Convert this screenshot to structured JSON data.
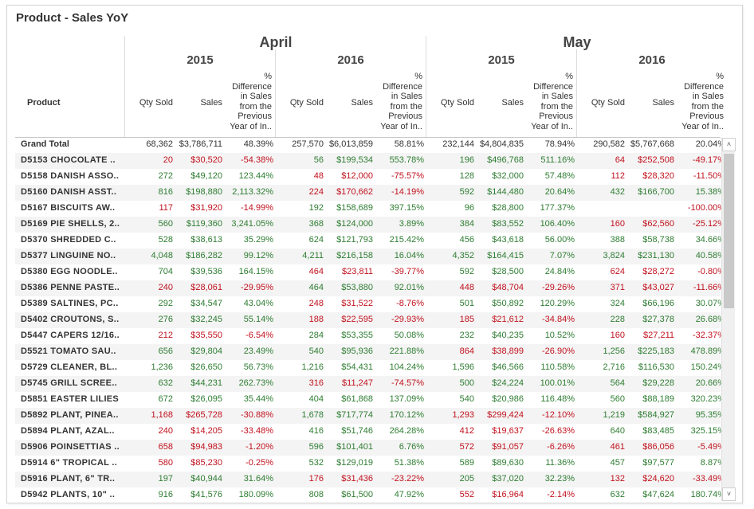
{
  "title": "Product - Sales YoY",
  "months": [
    "April",
    "May"
  ],
  "years": [
    "2015",
    "2016",
    "2015",
    "2016"
  ],
  "headers": {
    "product": "Product",
    "qty": "Qty Sold",
    "sales": "Sales",
    "pct_lines": [
      "%",
      "Difference",
      "in Sales",
      "from the",
      "Previous",
      "Year of In.."
    ]
  },
  "grand_total": {
    "label": "Grand Total",
    "cells": [
      "68,362",
      "$3,786,711",
      "48.39%",
      "257,570",
      "$6,013,859",
      "58.81%",
      "232,144",
      "$4,804,835",
      "78.94%",
      "290,582",
      "$5,767,668",
      "20.04%"
    ]
  },
  "rows": [
    {
      "product": "D5153  CHOCOLATE ..",
      "cells": [
        "20",
        "$30,520",
        "-54.38%",
        "56",
        "$199,534",
        "553.78%",
        "196",
        "$496,768",
        "511.16%",
        "64",
        "$252,508",
        "-49.17%"
      ]
    },
    {
      "product": "D5158  DANISH ASSO..",
      "cells": [
        "272",
        "$49,120",
        "123.44%",
        "48",
        "$12,000",
        "-75.57%",
        "128",
        "$32,000",
        "57.48%",
        "112",
        "$28,320",
        "-11.50%"
      ]
    },
    {
      "product": "D5160  DANISH ASST..",
      "cells": [
        "816",
        "$198,880",
        "2,113.32%",
        "224",
        "$170,662",
        "-14.19%",
        "592",
        "$144,480",
        "20.64%",
        "432",
        "$166,700",
        "15.38%"
      ]
    },
    {
      "product": "D5167  BISCUITS AW..",
      "cells": [
        "117",
        "$31,920",
        "-14.99%",
        "192",
        "$158,689",
        "397.15%",
        "96",
        "$28,800",
        "177.37%",
        "",
        "",
        "-100.00%"
      ]
    },
    {
      "product": "D5169  PIE SHELLS, 2..",
      "cells": [
        "560",
        "$119,360",
        "3,241.05%",
        "368",
        "$124,000",
        "3.89%",
        "384",
        "$83,552",
        "106.40%",
        "160",
        "$62,560",
        "-25.12%"
      ]
    },
    {
      "product": "D5370  SHREDDED C..",
      "cells": [
        "528",
        "$38,613",
        "35.29%",
        "624",
        "$121,793",
        "215.42%",
        "456",
        "$43,618",
        "56.00%",
        "388",
        "$58,738",
        "34.66%"
      ]
    },
    {
      "product": "D5377  LINGUINE NO..",
      "cells": [
        "4,048",
        "$186,282",
        "99.12%",
        "4,211",
        "$216,158",
        "16.04%",
        "4,352",
        "$164,415",
        "7.07%",
        "3,824",
        "$231,130",
        "40.58%"
      ]
    },
    {
      "product": "D5380  EGG NOODLE..",
      "cells": [
        "704",
        "$39,536",
        "164.15%",
        "464",
        "$23,811",
        "-39.77%",
        "592",
        "$28,500",
        "24.84%",
        "624",
        "$28,272",
        "-0.80%"
      ]
    },
    {
      "product": "D5386  PENNE PASTE..",
      "cells": [
        "240",
        "$28,061",
        "-29.95%",
        "464",
        "$53,880",
        "92.01%",
        "448",
        "$48,704",
        "-29.26%",
        "371",
        "$43,027",
        "-11.66%"
      ]
    },
    {
      "product": "D5389  SALTINES, PC..",
      "cells": [
        "292",
        "$34,547",
        "43.04%",
        "248",
        "$31,522",
        "-8.76%",
        "501",
        "$50,892",
        "120.29%",
        "324",
        "$66,196",
        "30.07%"
      ]
    },
    {
      "product": "D5402  CROUTONS, S..",
      "cells": [
        "276",
        "$32,245",
        "55.14%",
        "188",
        "$22,595",
        "-29.93%",
        "185",
        "$21,612",
        "-34.84%",
        "228",
        "$27,378",
        "26.68%"
      ]
    },
    {
      "product": "D5447  CAPERS 12/16..",
      "cells": [
        "212",
        "$35,550",
        "-6.54%",
        "284",
        "$53,355",
        "50.08%",
        "232",
        "$40,235",
        "10.52%",
        "160",
        "$27,211",
        "-32.37%"
      ]
    },
    {
      "product": "D5521  TOMATO SAU..",
      "cells": [
        "656",
        "$29,804",
        "23.49%",
        "540",
        "$95,936",
        "221.88%",
        "864",
        "$38,899",
        "-26.90%",
        "1,256",
        "$225,183",
        "478.89%"
      ]
    },
    {
      "product": "D5729  CLEANER, BL..",
      "cells": [
        "1,236",
        "$26,650",
        "56.73%",
        "1,216",
        "$54,431",
        "104.24%",
        "1,596",
        "$46,566",
        "110.58%",
        "2,716",
        "$116,530",
        "150.24%"
      ]
    },
    {
      "product": "D5745  GRILL SCREE..",
      "cells": [
        "632",
        "$44,231",
        "262.73%",
        "316",
        "$11,247",
        "-74.57%",
        "500",
        "$24,224",
        "100.01%",
        "564",
        "$29,228",
        "20.66%"
      ]
    },
    {
      "product": "D5851  EASTER LILIES",
      "cells": [
        "672",
        "$26,095",
        "35.44%",
        "404",
        "$61,868",
        "137.09%",
        "540",
        "$20,986",
        "116.48%",
        "560",
        "$88,189",
        "320.23%"
      ]
    },
    {
      "product": "D5892  PLANT, PINEA..",
      "cells": [
        "1,168",
        "$265,728",
        "-30.88%",
        "1,678",
        "$717,774",
        "170.12%",
        "1,293",
        "$299,424",
        "-12.10%",
        "1,219",
        "$584,927",
        "95.35%"
      ]
    },
    {
      "product": "D5894  PLANT, AZAL..",
      "cells": [
        "240",
        "$14,205",
        "-33.48%",
        "416",
        "$51,746",
        "264.28%",
        "412",
        "$19,637",
        "-26.63%",
        "640",
        "$83,485",
        "325.15%"
      ]
    },
    {
      "product": "D5906  POINSETTIAS ..",
      "cells": [
        "658",
        "$94,983",
        "-1.20%",
        "596",
        "$101,401",
        "6.76%",
        "572",
        "$91,057",
        "-6.26%",
        "461",
        "$86,056",
        "-5.49%"
      ]
    },
    {
      "product": "D5914  6\" TROPICAL ..",
      "cells": [
        "580",
        "$85,230",
        "-0.25%",
        "532",
        "$129,019",
        "51.38%",
        "589",
        "$89,630",
        "11.36%",
        "457",
        "$97,577",
        "8.87%"
      ]
    },
    {
      "product": "D5916  PLANT, 6\" TR..",
      "cells": [
        "197",
        "$40,944",
        "31.64%",
        "176",
        "$31,436",
        "-23.22%",
        "205",
        "$37,020",
        "32.23%",
        "132",
        "$24,620",
        "-33.49%"
      ]
    },
    {
      "product": "D5942  PLANTS, 10\" ..",
      "cells": [
        "916",
        "$41,576",
        "180.09%",
        "808",
        "$61,500",
        "47.92%",
        "552",
        "$16,964",
        "-2.14%",
        "632",
        "$47,624",
        "180.74%"
      ]
    }
  ],
  "colors": {
    "positive": "#2e7d32",
    "negative": "#c0121e"
  },
  "scrollbar": {
    "up_icon": "chevron-up-icon",
    "down_icon": "chevron-down-icon"
  }
}
